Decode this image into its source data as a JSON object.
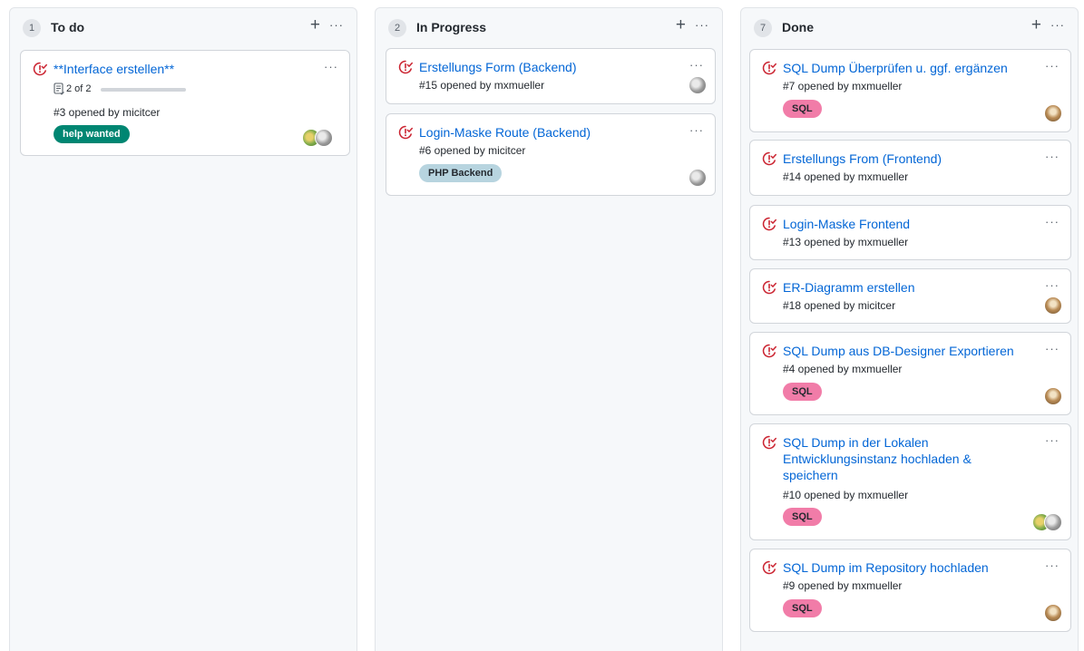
{
  "columns": [
    {
      "count": "1",
      "title": "To do",
      "cards": [
        {
          "title": "**Interface erstellen**",
          "progress_text": "2 of 2",
          "progress_done": 2,
          "progress_total": 2,
          "opened": "#3 opened by micitcer",
          "label": "help wanted"
        }
      ]
    },
    {
      "count": "2",
      "title": "In Progress",
      "cards": [
        {
          "title": "Erstellungs Form (Backend)",
          "opened": "#15 opened by mxmueller"
        },
        {
          "title": "Login-Maske Route (Backend)",
          "opened": "#6 opened by micitcer",
          "label": "PHP Backend"
        }
      ]
    },
    {
      "count": "7",
      "title": "Done",
      "cards": [
        {
          "title": "SQL Dump Überprüfen u. ggf. ergänzen",
          "opened": "#7 opened by mxmueller",
          "label": "SQL"
        },
        {
          "title": "Erstellungs From (Frontend)",
          "opened": "#14 opened by mxmueller"
        },
        {
          "title": "Login-Maske Frontend",
          "opened": "#13 opened by mxmueller"
        },
        {
          "title": "ER-Diagramm erstellen",
          "opened": "#18 opened by micitcer"
        },
        {
          "title": "SQL Dump aus DB-Designer Exportieren",
          "opened": "#4 opened by mxmueller",
          "label": "SQL"
        },
        {
          "title_lines": [
            "SQL Dump in der Lokalen",
            "Entwicklungsinstanz hochladen &",
            "speichern"
          ],
          "opened": "#10 opened by mxmueller",
          "label": "SQL"
        },
        {
          "title": "SQL Dump im Repository hochladen",
          "opened": "#9 opened by mxmueller",
          "label": "SQL"
        }
      ]
    }
  ],
  "glyphs": {
    "add": "+",
    "more": "···"
  },
  "colors": {
    "issue_closed": "#cb2431",
    "link": "#0366d6",
    "help_wanted": "#008672",
    "php_backend": "#b7d4df",
    "sql": "#f17ca8"
  }
}
